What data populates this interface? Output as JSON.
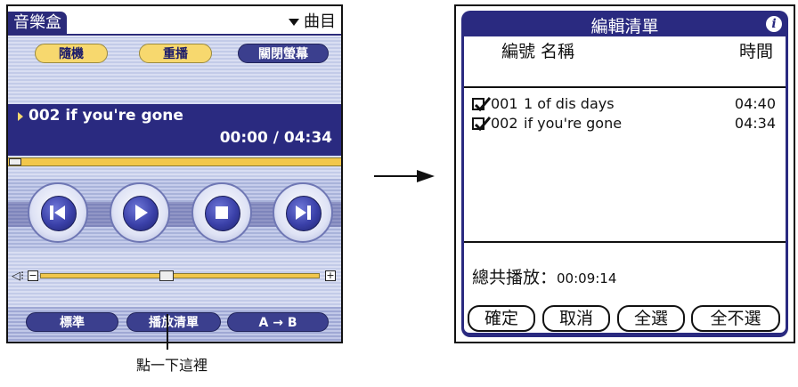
{
  "left": {
    "app_title": "音樂盒",
    "tracks_menu": "曲目",
    "buttons": {
      "shuffle": "隨機",
      "repeat": "重播",
      "screen_off": "關閉螢幕"
    },
    "now_playing": {
      "title": "002 if you're gone",
      "elapsed": "00:00",
      "duration": "04:34",
      "separator": "/"
    },
    "progress_fraction": 0.0,
    "volume_fraction": 0.45,
    "bottom_buttons": {
      "normal": "標準",
      "playlist": "播放清單",
      "ab": "A → B"
    }
  },
  "callout": "點一下這裡",
  "right": {
    "title": "編輯清單",
    "header_num_name": "編號 名稱",
    "header_time": "時間",
    "items": [
      {
        "num": "001",
        "name": "1 of dis days",
        "time": "04:40",
        "checked": true
      },
      {
        "num": "002",
        "name": "if you're gone",
        "time": "04:34",
        "checked": true
      }
    ],
    "total_label": "總共播放：",
    "total_value": "00:09:14",
    "buttons": {
      "ok": "確定",
      "cancel": "取消",
      "select_all": "全選",
      "select_none": "全不選"
    }
  },
  "colors": {
    "navy": "#2a2a80",
    "gold": "#f7d86e",
    "light_blue": "#c3cbe8"
  }
}
